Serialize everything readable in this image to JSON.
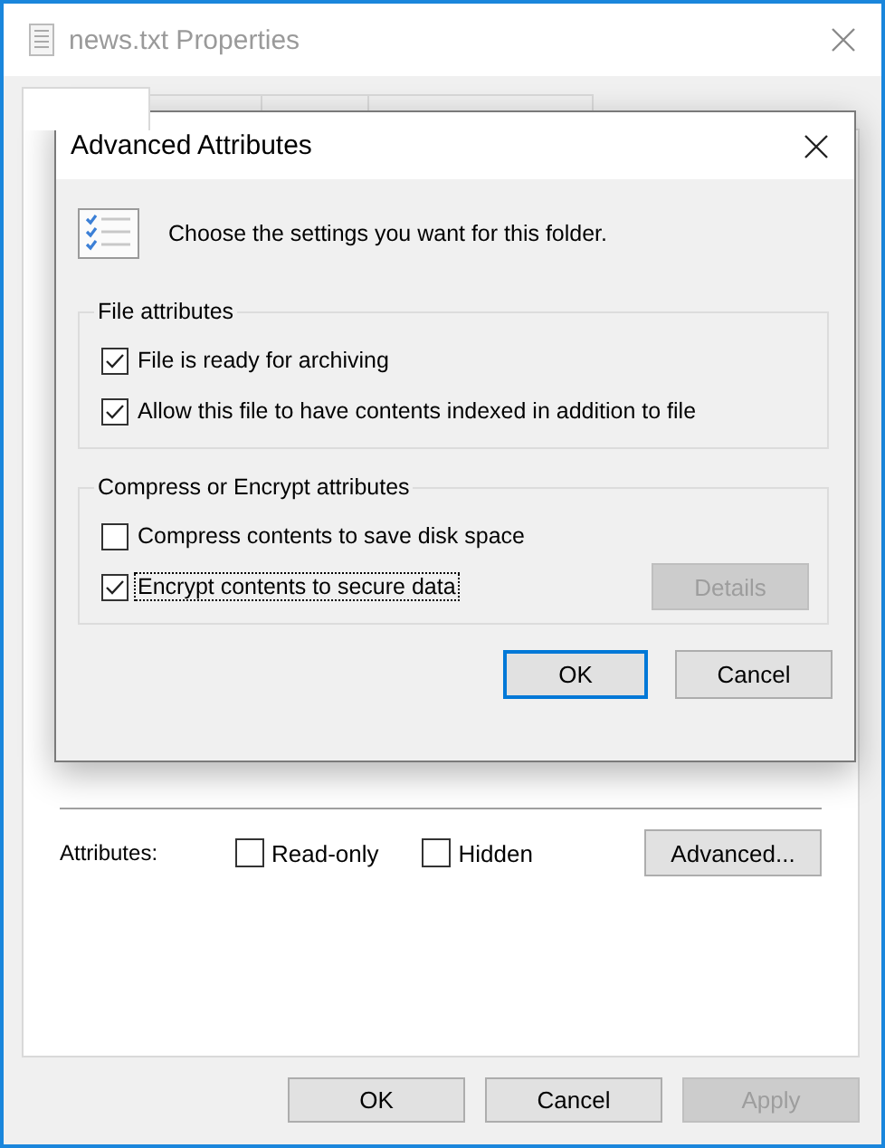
{
  "window": {
    "title": "news.txt Properties"
  },
  "tabs": [
    {
      "selected": true
    },
    {
      "selected": false
    },
    {
      "selected": false
    },
    {
      "selected": false
    }
  ],
  "general": {
    "attributes_label": "Attributes:",
    "attributes": [
      {
        "label": "Read-only",
        "checked": false
      },
      {
        "label": "Hidden",
        "checked": false
      }
    ],
    "advanced_button": "Advanced..."
  },
  "buttons": [
    {
      "label": "OK",
      "disabled": false
    },
    {
      "label": "Cancel",
      "disabled": false
    },
    {
      "label": "Apply",
      "disabled": true
    }
  ],
  "dialog": {
    "title": "Advanced Attributes",
    "intro": "Choose the settings you want for this folder.",
    "groups": [
      {
        "title": "File attributes",
        "options": [
          {
            "label": "File is ready for archiving",
            "checked": true,
            "focused": false
          },
          {
            "label": "Allow this file to have contents indexed in addition to file",
            "checked": true,
            "focused": false
          }
        ]
      },
      {
        "title": "Compress or Encrypt attributes",
        "options": [
          {
            "label": "Compress contents to save disk space",
            "checked": false,
            "focused": false
          },
          {
            "label": "Encrypt contents to secure data",
            "checked": true,
            "focused": true
          }
        ],
        "button": {
          "label": "Details",
          "disabled": true
        }
      }
    ],
    "buttons": [
      {
        "label": "OK",
        "default": true
      },
      {
        "label": "Cancel",
        "default": false
      }
    ]
  }
}
